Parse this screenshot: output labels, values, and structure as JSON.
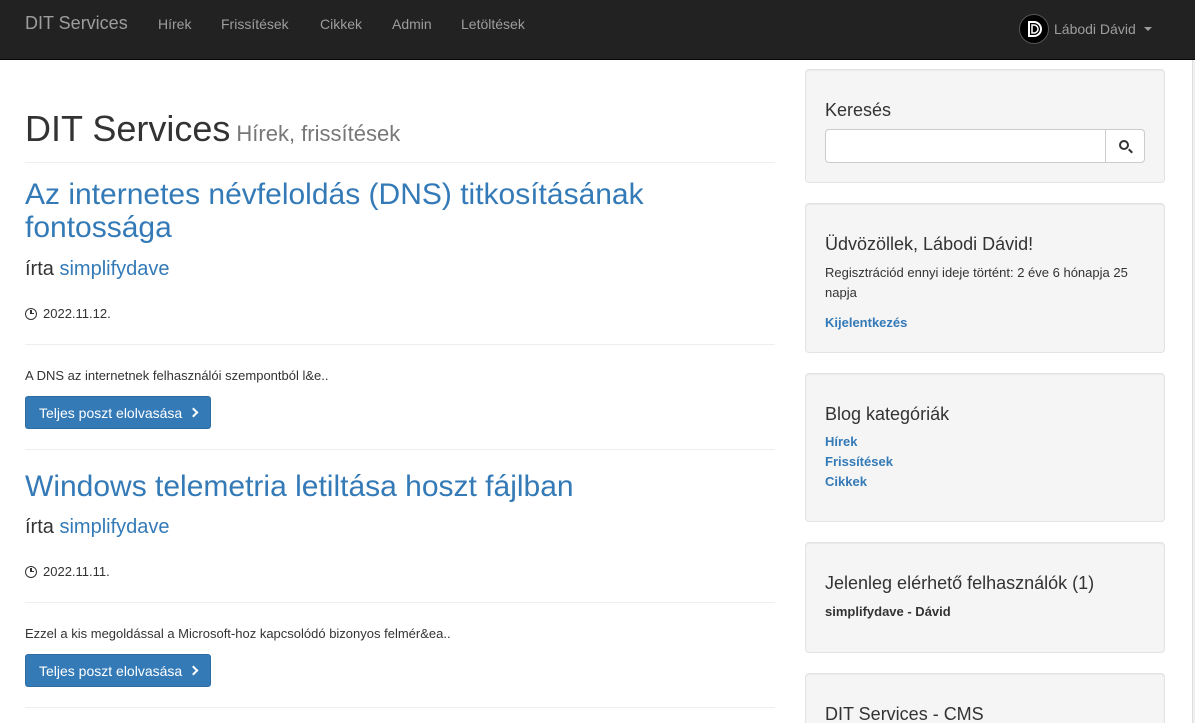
{
  "navbar": {
    "brand": "DIT Services",
    "links": [
      "Hírek",
      "Frissítések",
      "Cikkek",
      "Admin",
      "Letöltések"
    ],
    "user_name": "Lábodi Dávid"
  },
  "header": {
    "title": "DIT Services",
    "subtitle": "Hírek, frissítések"
  },
  "posts": [
    {
      "title": "Az internetes névfeloldás (DNS) titkosításának fontossága",
      "author_prefix": "írta",
      "author": "simplifydave",
      "date": "2022.11.12.",
      "excerpt": "A DNS az internetnek felhasználói szempontból l&e..",
      "button": "Teljes poszt elolvasása"
    },
    {
      "title": "Windows telemetria letiltása hoszt fájlban",
      "author_prefix": "írta",
      "author": "simplifydave",
      "date": "2022.11.11.",
      "excerpt": "Ezzel a kis megoldással a Microsoft-hoz kapcsolódó bizonyos felmér&ea..",
      "button": "Teljes poszt elolvasása"
    }
  ],
  "sidebar": {
    "search": {
      "title": "Keresés",
      "value": "",
      "placeholder": ""
    },
    "welcome": {
      "title": "Üdvözöllek, Lábodi Dávid!",
      "text": "Regisztrációd ennyi ideje történt: 2 éve 6 hónapja 25 napja",
      "logout": "Kijelentkezés"
    },
    "categories": {
      "title": "Blog kategóriák",
      "items": [
        "Hírek",
        "Frissítések",
        "Cikkek"
      ]
    },
    "online": {
      "title": "Jelenleg elérhető felhasználók (1)",
      "users": "simplifydave - Dávid"
    },
    "cms": {
      "title": "DIT Services - CMS"
    }
  },
  "colors": {
    "link": "#337ab7",
    "navbar": "#222222",
    "well": "#f5f5f5"
  },
  "icons": [
    "clock-icon",
    "chevron-right-icon",
    "search-icon",
    "user-logo-icon",
    "caret-down-icon"
  ]
}
